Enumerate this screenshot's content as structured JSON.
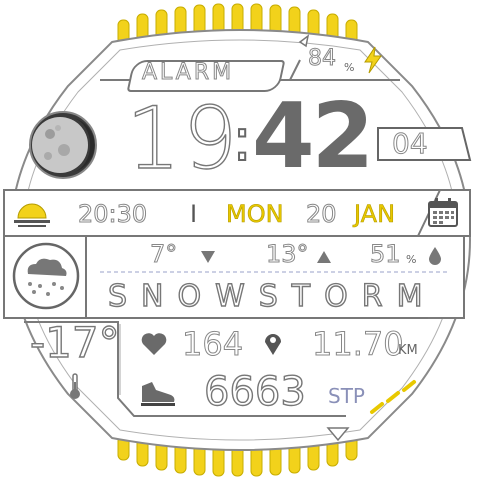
{
  "battery": {
    "value": "84",
    "unit": "%"
  },
  "alarm": {
    "label": "ALARM"
  },
  "time": {
    "hour": "19",
    "separator": ":",
    "minute": "42",
    "seconds": "04"
  },
  "sunset": {
    "time": "20:30"
  },
  "date": {
    "separator": "I",
    "weekday": "MON",
    "day": "20",
    "month": "JAN"
  },
  "weather": {
    "low": "7°",
    "high": "13°",
    "humidity": "51",
    "humidity_unit": "%",
    "condition": "SNOWSTORM",
    "current_temp": "-17°"
  },
  "health": {
    "heart_rate": "164",
    "distance": "11.70",
    "distance_unit": "KM",
    "steps": "6663",
    "steps_unit": "STP"
  },
  "colors": {
    "accent": "#f2d21b",
    "line": "#7a7a7a",
    "dark": "#555555"
  },
  "icons": [
    "charging-bolt-icon",
    "moon-phase-icon",
    "sunset-icon",
    "calendar-icon",
    "weather-cloud-icon",
    "arrow-down-icon",
    "arrow-up-icon",
    "droplet-icon",
    "heart-icon",
    "location-pin-icon",
    "thermometer-icon",
    "shoe-icon"
  ]
}
